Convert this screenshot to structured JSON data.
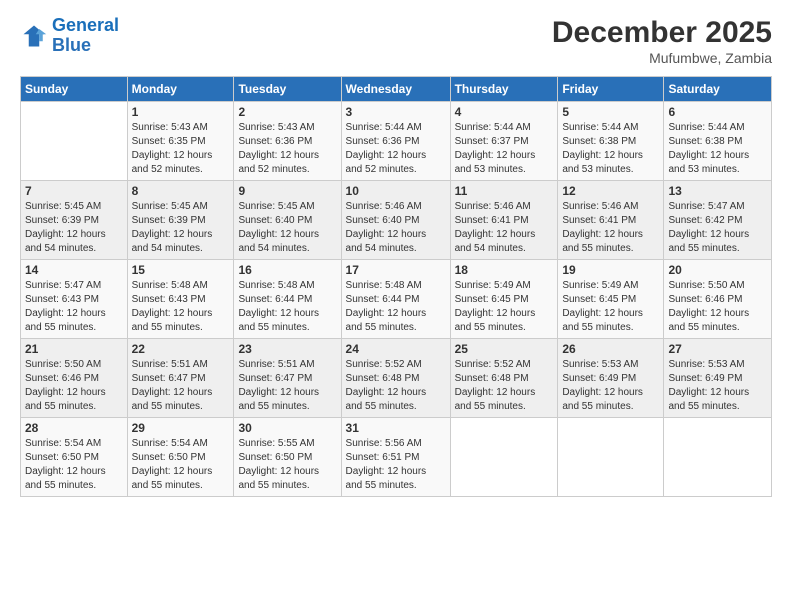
{
  "header": {
    "logo_line1": "General",
    "logo_line2": "Blue",
    "title": "December 2025",
    "subtitle": "Mufumbwe, Zambia"
  },
  "days_of_week": [
    "Sunday",
    "Monday",
    "Tuesday",
    "Wednesday",
    "Thursday",
    "Friday",
    "Saturday"
  ],
  "weeks": [
    [
      {
        "day": "",
        "content": ""
      },
      {
        "day": "1",
        "content": "Sunrise: 5:43 AM\nSunset: 6:35 PM\nDaylight: 12 hours\nand 52 minutes."
      },
      {
        "day": "2",
        "content": "Sunrise: 5:43 AM\nSunset: 6:36 PM\nDaylight: 12 hours\nand 52 minutes."
      },
      {
        "day": "3",
        "content": "Sunrise: 5:44 AM\nSunset: 6:36 PM\nDaylight: 12 hours\nand 52 minutes."
      },
      {
        "day": "4",
        "content": "Sunrise: 5:44 AM\nSunset: 6:37 PM\nDaylight: 12 hours\nand 53 minutes."
      },
      {
        "day": "5",
        "content": "Sunrise: 5:44 AM\nSunset: 6:38 PM\nDaylight: 12 hours\nand 53 minutes."
      },
      {
        "day": "6",
        "content": "Sunrise: 5:44 AM\nSunset: 6:38 PM\nDaylight: 12 hours\nand 53 minutes."
      }
    ],
    [
      {
        "day": "7",
        "content": "Sunrise: 5:45 AM\nSunset: 6:39 PM\nDaylight: 12 hours\nand 54 minutes."
      },
      {
        "day": "8",
        "content": "Sunrise: 5:45 AM\nSunset: 6:39 PM\nDaylight: 12 hours\nand 54 minutes."
      },
      {
        "day": "9",
        "content": "Sunrise: 5:45 AM\nSunset: 6:40 PM\nDaylight: 12 hours\nand 54 minutes."
      },
      {
        "day": "10",
        "content": "Sunrise: 5:46 AM\nSunset: 6:40 PM\nDaylight: 12 hours\nand 54 minutes."
      },
      {
        "day": "11",
        "content": "Sunrise: 5:46 AM\nSunset: 6:41 PM\nDaylight: 12 hours\nand 54 minutes."
      },
      {
        "day": "12",
        "content": "Sunrise: 5:46 AM\nSunset: 6:41 PM\nDaylight: 12 hours\nand 55 minutes."
      },
      {
        "day": "13",
        "content": "Sunrise: 5:47 AM\nSunset: 6:42 PM\nDaylight: 12 hours\nand 55 minutes."
      }
    ],
    [
      {
        "day": "14",
        "content": "Sunrise: 5:47 AM\nSunset: 6:43 PM\nDaylight: 12 hours\nand 55 minutes."
      },
      {
        "day": "15",
        "content": "Sunrise: 5:48 AM\nSunset: 6:43 PM\nDaylight: 12 hours\nand 55 minutes."
      },
      {
        "day": "16",
        "content": "Sunrise: 5:48 AM\nSunset: 6:44 PM\nDaylight: 12 hours\nand 55 minutes."
      },
      {
        "day": "17",
        "content": "Sunrise: 5:48 AM\nSunset: 6:44 PM\nDaylight: 12 hours\nand 55 minutes."
      },
      {
        "day": "18",
        "content": "Sunrise: 5:49 AM\nSunset: 6:45 PM\nDaylight: 12 hours\nand 55 minutes."
      },
      {
        "day": "19",
        "content": "Sunrise: 5:49 AM\nSunset: 6:45 PM\nDaylight: 12 hours\nand 55 minutes."
      },
      {
        "day": "20",
        "content": "Sunrise: 5:50 AM\nSunset: 6:46 PM\nDaylight: 12 hours\nand 55 minutes."
      }
    ],
    [
      {
        "day": "21",
        "content": "Sunrise: 5:50 AM\nSunset: 6:46 PM\nDaylight: 12 hours\nand 55 minutes."
      },
      {
        "day": "22",
        "content": "Sunrise: 5:51 AM\nSunset: 6:47 PM\nDaylight: 12 hours\nand 55 minutes."
      },
      {
        "day": "23",
        "content": "Sunrise: 5:51 AM\nSunset: 6:47 PM\nDaylight: 12 hours\nand 55 minutes."
      },
      {
        "day": "24",
        "content": "Sunrise: 5:52 AM\nSunset: 6:48 PM\nDaylight: 12 hours\nand 55 minutes."
      },
      {
        "day": "25",
        "content": "Sunrise: 5:52 AM\nSunset: 6:48 PM\nDaylight: 12 hours\nand 55 minutes."
      },
      {
        "day": "26",
        "content": "Sunrise: 5:53 AM\nSunset: 6:49 PM\nDaylight: 12 hours\nand 55 minutes."
      },
      {
        "day": "27",
        "content": "Sunrise: 5:53 AM\nSunset: 6:49 PM\nDaylight: 12 hours\nand 55 minutes."
      }
    ],
    [
      {
        "day": "28",
        "content": "Sunrise: 5:54 AM\nSunset: 6:50 PM\nDaylight: 12 hours\nand 55 minutes."
      },
      {
        "day": "29",
        "content": "Sunrise: 5:54 AM\nSunset: 6:50 PM\nDaylight: 12 hours\nand 55 minutes."
      },
      {
        "day": "30",
        "content": "Sunrise: 5:55 AM\nSunset: 6:50 PM\nDaylight: 12 hours\nand 55 minutes."
      },
      {
        "day": "31",
        "content": "Sunrise: 5:56 AM\nSunset: 6:51 PM\nDaylight: 12 hours\nand 55 minutes."
      },
      {
        "day": "",
        "content": ""
      },
      {
        "day": "",
        "content": ""
      },
      {
        "day": "",
        "content": ""
      }
    ]
  ]
}
